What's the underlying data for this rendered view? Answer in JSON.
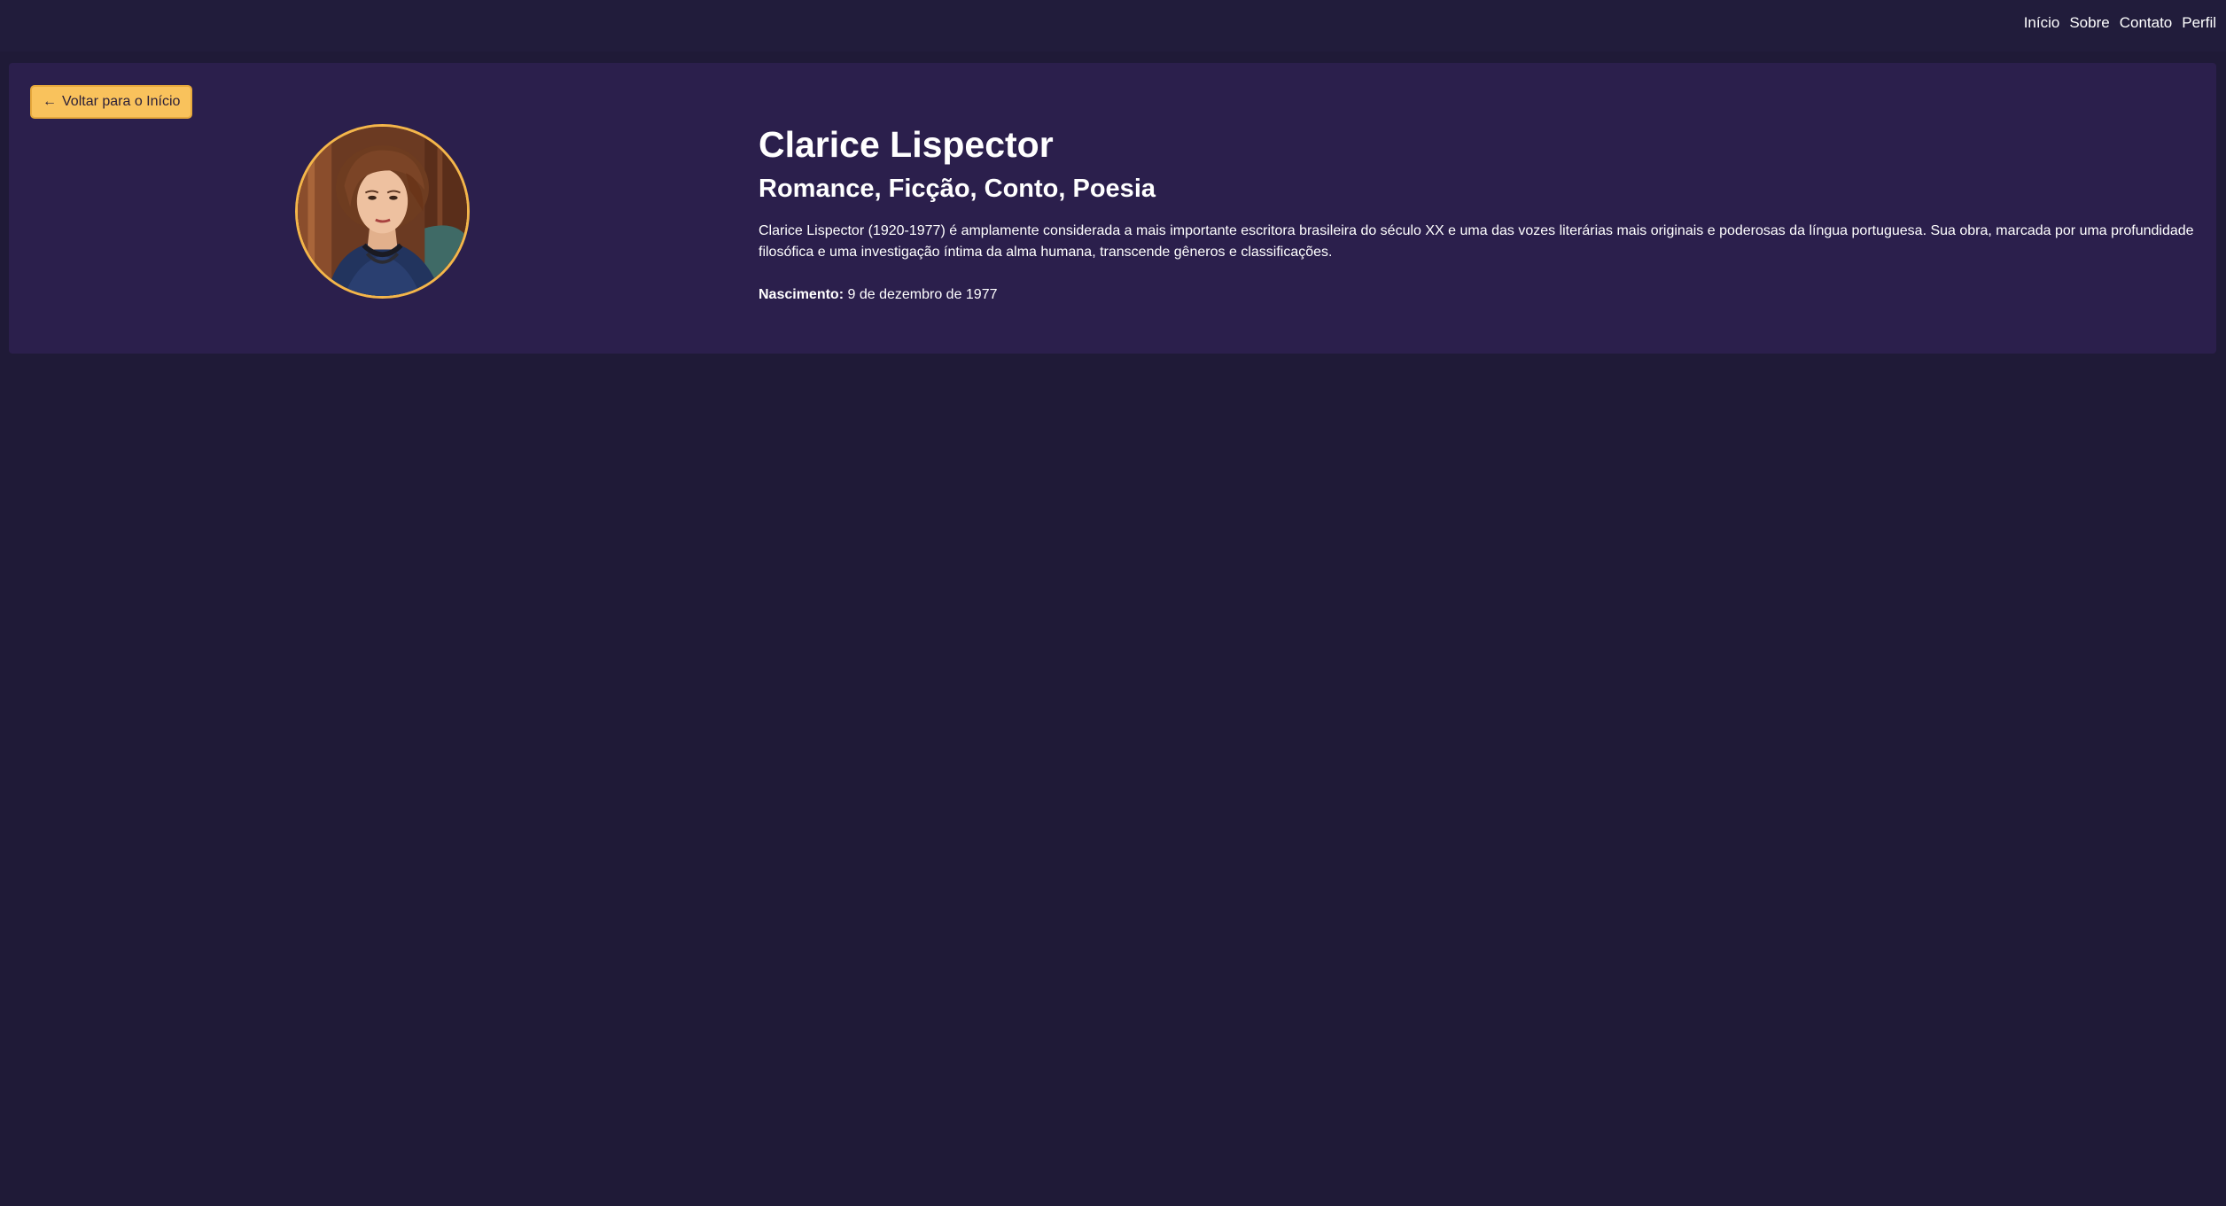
{
  "nav": {
    "items": [
      {
        "label": "Início"
      },
      {
        "label": "Sobre"
      },
      {
        "label": "Contato"
      },
      {
        "label": "Perfil"
      }
    ]
  },
  "back_button": {
    "arrow": "←",
    "label": "Voltar para o Início"
  },
  "author": {
    "name": "Clarice Lispector",
    "genres": "Romance, Ficção, Conto, Poesia",
    "bio": "Clarice Lispector (1920-1977) é amplamente considerada a mais importante escritora brasileira do século XX e uma das vozes literárias mais originais e poderosas da língua portuguesa. Sua obra, marcada por uma profundidade filosófica e uma investigação íntima da alma humana, transcende gêneros e classificações.",
    "birth_label": "Nascimento:",
    "birth_value": "9 de dezembro de 1977"
  },
  "colors": {
    "background": "#1f1a37",
    "card": "#2b1f4c",
    "accent": "#f9c25c",
    "avatar_border": "#f4b64a"
  }
}
